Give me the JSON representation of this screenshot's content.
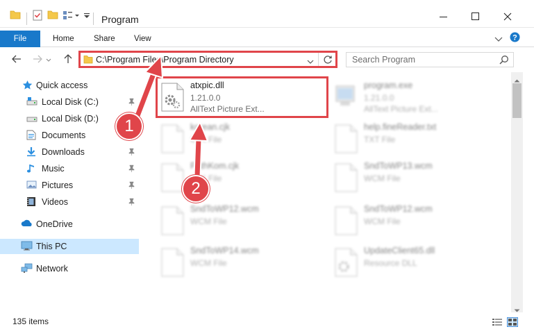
{
  "window": {
    "title": "Program",
    "controls": {
      "minimize": "minimize-icon",
      "maximize": "maximize-icon",
      "close": "close-icon"
    }
  },
  "ribbon": {
    "tabs": [
      {
        "label": "File",
        "active": true
      },
      {
        "label": "Home"
      },
      {
        "label": "Share"
      },
      {
        "label": "View"
      }
    ]
  },
  "navigation": {
    "address_path": "C:\\Program Files\\Program Directory",
    "search_placeholder": "Search Program"
  },
  "sidebar": {
    "items": [
      {
        "label": "Quick access",
        "icon": "star-icon",
        "pinned": false
      },
      {
        "label": "Local Disk (C:)",
        "icon": "drive-icon",
        "pinned": true
      },
      {
        "label": "Local Disk (D:)",
        "icon": "drive-icon",
        "pinned": false
      },
      {
        "label": "Documents",
        "icon": "documents-icon",
        "pinned": true
      },
      {
        "label": "Downloads",
        "icon": "downloads-icon",
        "pinned": true
      },
      {
        "label": "Music",
        "icon": "music-icon",
        "pinned": true
      },
      {
        "label": "Pictures",
        "icon": "pictures-icon",
        "pinned": true
      },
      {
        "label": "Videos",
        "icon": "videos-icon",
        "pinned": true
      },
      {
        "label": "OneDrive",
        "icon": "onedrive-icon",
        "pinned": false
      },
      {
        "label": "This PC",
        "icon": "pc-icon",
        "pinned": false,
        "selected": true
      },
      {
        "label": "Network",
        "icon": "network-icon",
        "pinned": false
      }
    ]
  },
  "files": [
    {
      "name": "atxpic.dll",
      "line2": "1.21.0.0",
      "line3": "AllText Picture Ext...",
      "type": "dll",
      "highlighted": true
    },
    {
      "name": "program.exe",
      "line2": "1.21.0.0",
      "line3": "AllText Picture Ext...",
      "type": "exe"
    },
    {
      "name": "korean.cjk",
      "line2": "CJK File",
      "type": "file"
    },
    {
      "name": "help.fineReader.txt",
      "line2": "TXT File",
      "type": "file"
    },
    {
      "name": "PathKom.cjk",
      "line2": "CJK File",
      "type": "file"
    },
    {
      "name": "SndToWP13.wcm",
      "line2": "WCM File",
      "type": "file"
    },
    {
      "name": "SndToWP12.wcm",
      "line2": "WCM File",
      "type": "file"
    },
    {
      "name": "SndToWP12.wcm",
      "line2": "WCM File",
      "type": "file"
    },
    {
      "name": "SndToWP14.wcm",
      "line2": "WCM File",
      "type": "file"
    },
    {
      "name": "UpdateClient65.dll",
      "line2": "Resource DLL",
      "type": "dll"
    }
  ],
  "status": {
    "item_count": "135 items"
  },
  "annotations": [
    {
      "number": "1",
      "target": "address bar"
    },
    {
      "number": "2",
      "target": "atxpic.dll"
    }
  ],
  "colors": {
    "accent": "#1979ca",
    "annotation": "#e0454a",
    "selection": "#cce8ff"
  }
}
